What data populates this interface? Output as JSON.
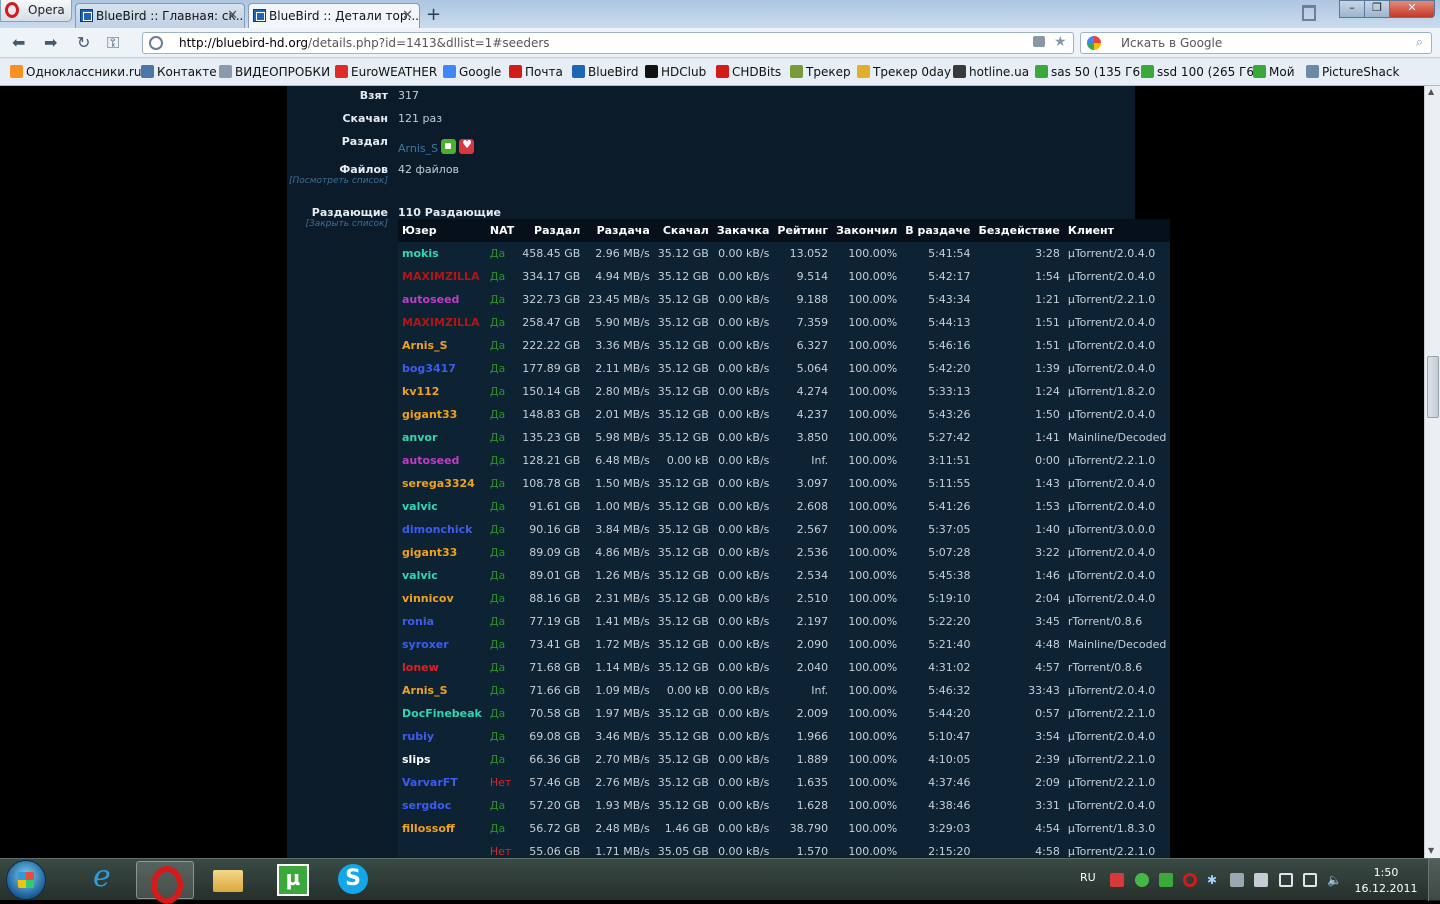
{
  "browser": {
    "app_button": "Opera",
    "tabs": [
      {
        "label": "BlueBird :: Главная: ск...",
        "active": false
      },
      {
        "label": "BlueBird :: Детали тор...",
        "active": true
      }
    ],
    "url_host": "http://bluebird-hd.org",
    "url_path": "/details.php?id=1413&dllist=1#seeders",
    "search_placeholder": "Искать в Google",
    "bookmarks": [
      {
        "label": "Одноклассники.ru",
        "icon": "odnoklassniki-icon",
        "color": "#f79222"
      },
      {
        "label": "Контакте",
        "icon": "vkontakte-icon",
        "color": "#4a76a8"
      },
      {
        "label": "ВИДЕОПРОБКИ",
        "icon": "video-icon",
        "color": "#8a9aab"
      },
      {
        "label": "EuroWEATHER",
        "icon": "weather-icon",
        "color": "#e02b2b"
      },
      {
        "label": "Google",
        "icon": "google-icon",
        "color": "#4285f4"
      },
      {
        "label": "Почта",
        "icon": "mail-icon",
        "color": "#d31b1b"
      },
      {
        "label": "BlueBird",
        "icon": "bluebird-icon",
        "color": "#1f65b5"
      },
      {
        "label": "HDClub",
        "icon": "hdclub-icon",
        "color": "#111111"
      },
      {
        "label": "CHDBits",
        "icon": "chdbits-icon",
        "color": "#d31b1b"
      },
      {
        "label": "Трекер",
        "icon": "tracker-icon",
        "color": "#7a9a3a"
      },
      {
        "label": "Трекер 0day",
        "icon": "tracker-0day-icon",
        "color": "#e0b02a"
      },
      {
        "label": "hotline.ua",
        "icon": "hotline-icon",
        "color": "#3a3a3a"
      },
      {
        "label": "sas 50 (135 Г6)",
        "icon": "sas50-icon",
        "color": "#3aa83a"
      },
      {
        "label": "ssd 100 (265 Г6)",
        "icon": "ssd100-icon",
        "color": "#3aa83a"
      },
      {
        "label": "Мой",
        "icon": "moy-icon",
        "color": "#3aa83a"
      },
      {
        "label": "PictureShack",
        "icon": "pictureshack-icon",
        "color": "#6a8aa8"
      }
    ]
  },
  "details": {
    "taken_label": "Взят",
    "taken_value": "317",
    "downloaded_label": "Скачан",
    "downloaded_value": "121 раз",
    "uploaded_by_label": "Раздал",
    "uploaded_by_value": "Arnis_S",
    "files_label": "Файлов",
    "files_link": "[Посмотреть список]",
    "files_value": "42 файлов",
    "seeders_label": "Раздающие",
    "seeders_link": "[Закрыть список]",
    "seeders_value": "110 Раздающие"
  },
  "peers": {
    "columns": [
      "Юзер",
      "NAT",
      "Раздал",
      "Раздача",
      "Скачал",
      "Закачка",
      "Рейтинг",
      "Закончил",
      "В раздаче",
      "Бездействие",
      "Клиент"
    ],
    "rows": [
      {
        "user": "mokis",
        "color": "#2fd8b0",
        "nat": "Да",
        "uploaded": "458.45 GB",
        "up_speed": "2.96 MB/s",
        "downloaded": "35.12 GB",
        "down_speed": "0.00 kB/s",
        "ratio": "13.052",
        "finished": "100.00%",
        "seeding": "5:41:54",
        "idle": "3:28",
        "client": "µTorrent/2.0.4.0"
      },
      {
        "user": "MAXIMZILLA",
        "color": "#b01616",
        "nat": "Да",
        "uploaded": "334.17 GB",
        "up_speed": "4.94 MB/s",
        "downloaded": "35.12 GB",
        "down_speed": "0.00 kB/s",
        "ratio": "9.514",
        "finished": "100.00%",
        "seeding": "5:42:17",
        "idle": "1:54",
        "client": "µTorrent/2.0.4.0"
      },
      {
        "user": "autoseed",
        "color": "#c23cc9",
        "nat": "Да",
        "uploaded": "322.73 GB",
        "up_speed": "23.45 MB/s",
        "downloaded": "35.12 GB",
        "down_speed": "0.00 kB/s",
        "ratio": "9.188",
        "finished": "100.00%",
        "seeding": "5:43:34",
        "idle": "1:21",
        "client": "µTorrent/2.2.1.0"
      },
      {
        "user": "MAXIMZILLA",
        "color": "#b01616",
        "nat": "Да",
        "uploaded": "258.47 GB",
        "up_speed": "5.90 MB/s",
        "downloaded": "35.12 GB",
        "down_speed": "0.00 kB/s",
        "ratio": "7.359",
        "finished": "100.00%",
        "seeding": "5:44:13",
        "idle": "1:51",
        "client": "µTorrent/2.0.4.0"
      },
      {
        "user": "Arnis_S",
        "color": "#f0a21e",
        "nat": "Да",
        "uploaded": "222.22 GB",
        "up_speed": "3.36 MB/s",
        "downloaded": "35.12 GB",
        "down_speed": "0.00 kB/s",
        "ratio": "6.327",
        "finished": "100.00%",
        "seeding": "5:46:16",
        "idle": "1:51",
        "client": "µTorrent/2.0.4.0"
      },
      {
        "user": "bog3417",
        "color": "#3c5cf0",
        "nat": "Да",
        "uploaded": "177.89 GB",
        "up_speed": "2.11 MB/s",
        "downloaded": "35.12 GB",
        "down_speed": "0.00 kB/s",
        "ratio": "5.064",
        "finished": "100.00%",
        "seeding": "5:42:20",
        "idle": "1:39",
        "client": "µTorrent/2.0.4.0"
      },
      {
        "user": "kv112",
        "color": "#f0a21e",
        "nat": "Да",
        "uploaded": "150.14 GB",
        "up_speed": "2.80 MB/s",
        "downloaded": "35.12 GB",
        "down_speed": "0.00 kB/s",
        "ratio": "4.274",
        "finished": "100.00%",
        "seeding": "5:33:13",
        "idle": "1:24",
        "client": "µTorrent/1.8.2.0"
      },
      {
        "user": "gigant33",
        "color": "#f0a21e",
        "nat": "Да",
        "uploaded": "148.83 GB",
        "up_speed": "2.01 MB/s",
        "downloaded": "35.12 GB",
        "down_speed": "0.00 kB/s",
        "ratio": "4.237",
        "finished": "100.00%",
        "seeding": "5:43:26",
        "idle": "1:50",
        "client": "µTorrent/2.0.4.0"
      },
      {
        "user": "anvor",
        "color": "#2fd8b0",
        "nat": "Да",
        "uploaded": "135.23 GB",
        "up_speed": "5.98 MB/s",
        "downloaded": "35.12 GB",
        "down_speed": "0.00 kB/s",
        "ratio": "3.850",
        "finished": "100.00%",
        "seeding": "5:27:42",
        "idle": "1:41",
        "client": "Mainline/Decoded"
      },
      {
        "user": "autoseed",
        "color": "#c23cc9",
        "nat": "Да",
        "uploaded": "128.21 GB",
        "up_speed": "6.48 MB/s",
        "downloaded": "0.00 kB",
        "down_speed": "0.00 kB/s",
        "ratio": "Inf.",
        "finished": "100.00%",
        "seeding": "3:11:51",
        "idle": "0:00",
        "client": "µTorrent/2.2.1.0"
      },
      {
        "user": "serega3324",
        "color": "#f0a21e",
        "nat": "Да",
        "uploaded": "108.78 GB",
        "up_speed": "1.50 MB/s",
        "downloaded": "35.12 GB",
        "down_speed": "0.00 kB/s",
        "ratio": "3.097",
        "finished": "100.00%",
        "seeding": "5:11:55",
        "idle": "1:43",
        "client": "µTorrent/2.0.4.0"
      },
      {
        "user": "valvic",
        "color": "#2fd8b0",
        "nat": "Да",
        "uploaded": "91.61 GB",
        "up_speed": "1.00 MB/s",
        "downloaded": "35.12 GB",
        "down_speed": "0.00 kB/s",
        "ratio": "2.608",
        "finished": "100.00%",
        "seeding": "5:41:26",
        "idle": "1:53",
        "client": "µTorrent/2.0.4.0"
      },
      {
        "user": "dimonchick",
        "color": "#3c5cf0",
        "nat": "Да",
        "uploaded": "90.16 GB",
        "up_speed": "3.84 MB/s",
        "downloaded": "35.12 GB",
        "down_speed": "0.00 kB/s",
        "ratio": "2.567",
        "finished": "100.00%",
        "seeding": "5:37:05",
        "idle": "1:40",
        "client": "µTorrent/3.0.0.0"
      },
      {
        "user": "gigant33",
        "color": "#f0a21e",
        "nat": "Да",
        "uploaded": "89.09 GB",
        "up_speed": "4.86 MB/s",
        "downloaded": "35.12 GB",
        "down_speed": "0.00 kB/s",
        "ratio": "2.536",
        "finished": "100.00%",
        "seeding": "5:07:28",
        "idle": "3:22",
        "client": "µTorrent/2.0.4.0"
      },
      {
        "user": "valvic",
        "color": "#2fd8b0",
        "nat": "Да",
        "uploaded": "89.01 GB",
        "up_speed": "1.26 MB/s",
        "downloaded": "35.12 GB",
        "down_speed": "0.00 kB/s",
        "ratio": "2.534",
        "finished": "100.00%",
        "seeding": "5:45:38",
        "idle": "1:46",
        "client": "µTorrent/2.0.4.0"
      },
      {
        "user": "vinnicov",
        "color": "#f0a21e",
        "nat": "Да",
        "uploaded": "88.16 GB",
        "up_speed": "2.31 MB/s",
        "downloaded": "35.12 GB",
        "down_speed": "0.00 kB/s",
        "ratio": "2.510",
        "finished": "100.00%",
        "seeding": "5:19:10",
        "idle": "2:04",
        "client": "µTorrent/2.0.4.0"
      },
      {
        "user": "ronia",
        "color": "#3c5cf0",
        "nat": "Да",
        "uploaded": "77.19 GB",
        "up_speed": "1.41 MB/s",
        "downloaded": "35.12 GB",
        "down_speed": "0.00 kB/s",
        "ratio": "2.197",
        "finished": "100.00%",
        "seeding": "5:22:20",
        "idle": "3:45",
        "client": "rTorrent/0.8.6"
      },
      {
        "user": "syroxer",
        "color": "#3c5cf0",
        "nat": "Да",
        "uploaded": "73.41 GB",
        "up_speed": "1.72 MB/s",
        "downloaded": "35.12 GB",
        "down_speed": "0.00 kB/s",
        "ratio": "2.090",
        "finished": "100.00%",
        "seeding": "5:21:40",
        "idle": "4:48",
        "client": "Mainline/Decoded"
      },
      {
        "user": "lonew",
        "color": "#e02020",
        "nat": "Да",
        "uploaded": "71.68 GB",
        "up_speed": "1.14 MB/s",
        "downloaded": "35.12 GB",
        "down_speed": "0.00 kB/s",
        "ratio": "2.040",
        "finished": "100.00%",
        "seeding": "4:31:02",
        "idle": "4:57",
        "client": "rTorrent/0.8.6"
      },
      {
        "user": "Arnis_S",
        "color": "#f0a21e",
        "nat": "Да",
        "uploaded": "71.66 GB",
        "up_speed": "1.09 MB/s",
        "downloaded": "0.00 kB",
        "down_speed": "0.00 kB/s",
        "ratio": "Inf.",
        "finished": "100.00%",
        "seeding": "5:46:32",
        "idle": "33:43",
        "client": "µTorrent/2.0.4.0"
      },
      {
        "user": "DocFinebeak",
        "color": "#2fd8b0",
        "nat": "Да",
        "uploaded": "70.58 GB",
        "up_speed": "1.97 MB/s",
        "downloaded": "35.12 GB",
        "down_speed": "0.00 kB/s",
        "ratio": "2.009",
        "finished": "100.00%",
        "seeding": "5:44:20",
        "idle": "0:57",
        "client": "µTorrent/2.2.1.0"
      },
      {
        "user": "rubiy",
        "color": "#3c5cf0",
        "nat": "Да",
        "uploaded": "69.08 GB",
        "up_speed": "3.46 MB/s",
        "downloaded": "35.12 GB",
        "down_speed": "0.00 kB/s",
        "ratio": "1.966",
        "finished": "100.00%",
        "seeding": "5:10:47",
        "idle": "3:54",
        "client": "µTorrent/2.0.4.0"
      },
      {
        "user": "slips",
        "color": "#ffffff",
        "nat": "Да",
        "uploaded": "66.36 GB",
        "up_speed": "2.70 MB/s",
        "downloaded": "35.12 GB",
        "down_speed": "0.00 kB/s",
        "ratio": "1.889",
        "finished": "100.00%",
        "seeding": "4:10:05",
        "idle": "2:39",
        "client": "µTorrent/2.2.1.0"
      },
      {
        "user": "VarvarFT",
        "color": "#3c5cf0",
        "nat": "Нет",
        "uploaded": "57.46 GB",
        "up_speed": "2.76 MB/s",
        "downloaded": "35.12 GB",
        "down_speed": "0.00 kB/s",
        "ratio": "1.635",
        "finished": "100.00%",
        "seeding": "4:37:46",
        "idle": "2:09",
        "client": "µTorrent/2.2.1.0"
      },
      {
        "user": "sergdoc",
        "color": "#3c5cf0",
        "nat": "Да",
        "uploaded": "57.20 GB",
        "up_speed": "1.93 MB/s",
        "downloaded": "35.12 GB",
        "down_speed": "0.00 kB/s",
        "ratio": "1.628",
        "finished": "100.00%",
        "seeding": "4:38:46",
        "idle": "3:31",
        "client": "µTorrent/2.0.4.0"
      },
      {
        "user": "fillossoff",
        "color": "#f0a21e",
        "nat": "Да",
        "uploaded": "56.72 GB",
        "up_speed": "2.48 MB/s",
        "downloaded": "1.46 GB",
        "down_speed": "0.00 kB/s",
        "ratio": "38.790",
        "finished": "100.00%",
        "seeding": "3:29:03",
        "idle": "4:54",
        "client": "µTorrent/1.8.3.0"
      },
      {
        "user": "",
        "color": "#3c5cf0",
        "nat": "Нет",
        "uploaded": "55.06 GB",
        "up_speed": "1.71 MB/s",
        "downloaded": "35.05 GB",
        "down_speed": "0.00 kB/s",
        "ratio": "1.570",
        "finished": "100.00%",
        "seeding": "2:15:20",
        "idle": "4:58",
        "client": "µTorrent/2.2.1.0"
      }
    ]
  },
  "taskbar": {
    "lang": "RU",
    "time": "1:50",
    "date": "16.12.2011"
  }
}
